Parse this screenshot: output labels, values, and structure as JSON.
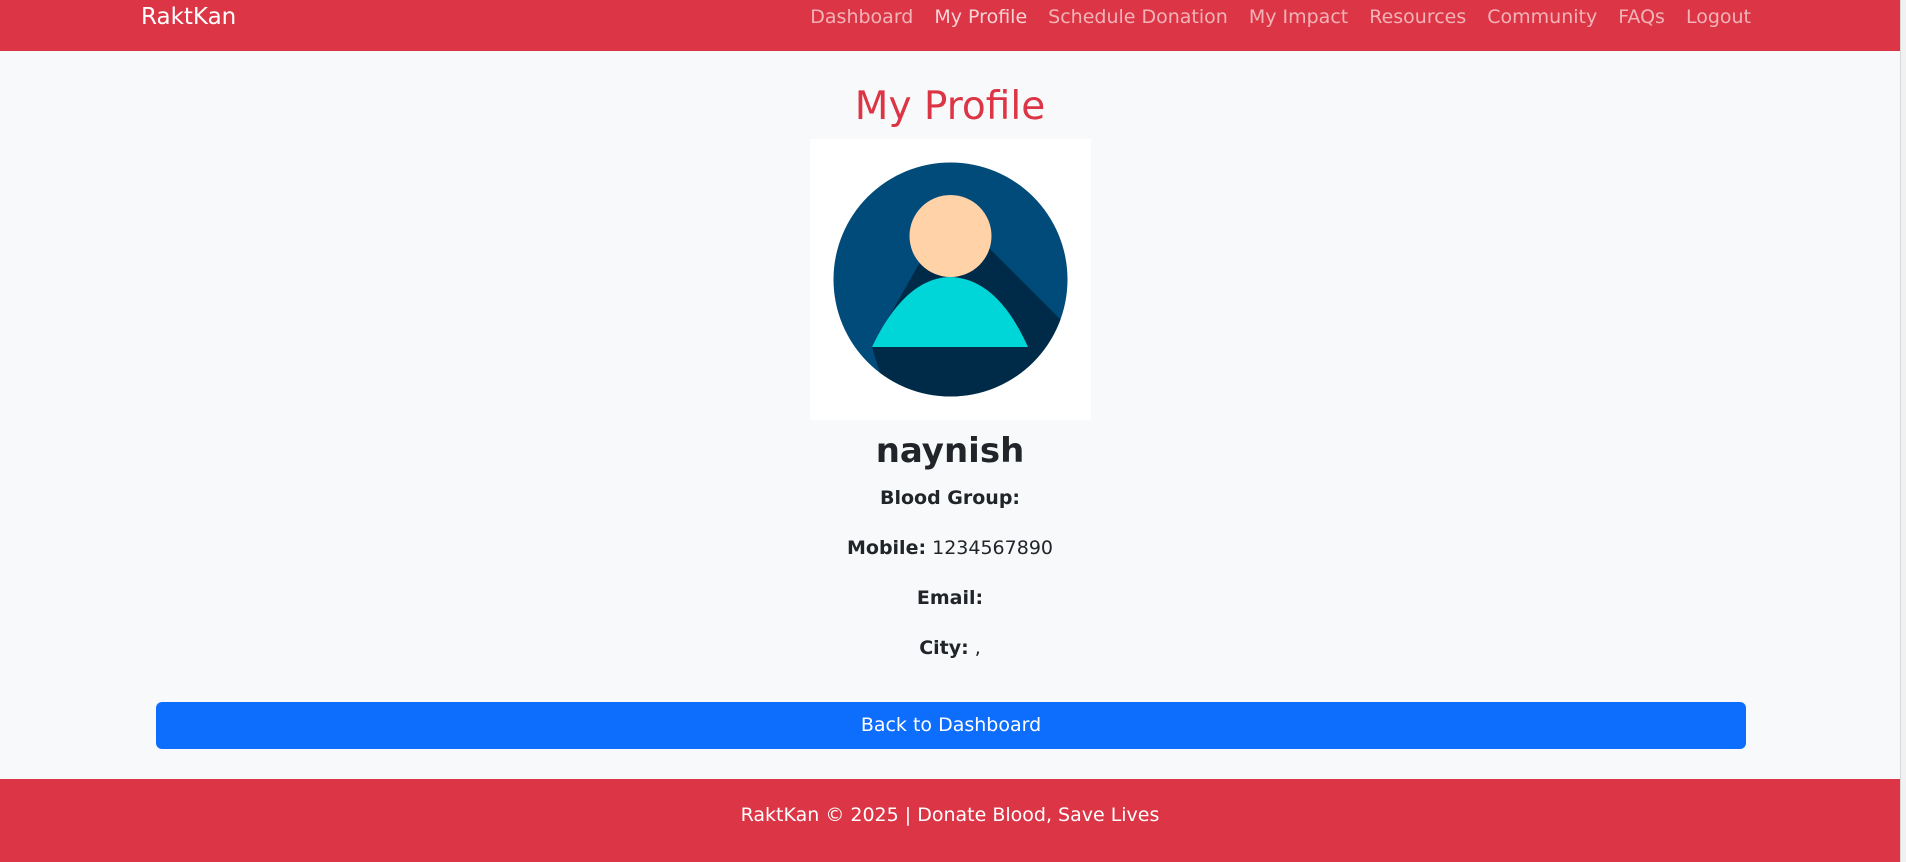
{
  "navbar": {
    "brand": "RaktKan",
    "items": [
      {
        "label": "Dashboard"
      },
      {
        "label": "My Profile"
      },
      {
        "label": "Schedule Donation"
      },
      {
        "label": "My Impact"
      },
      {
        "label": "Resources"
      },
      {
        "label": "Community"
      },
      {
        "label": "FAQs"
      },
      {
        "label": "Logout"
      }
    ]
  },
  "profile": {
    "title": "My Profile",
    "avatar_icon": "user-avatar-icon",
    "username": "naynish",
    "fields": [
      {
        "label": "Blood Group:",
        "value": ""
      },
      {
        "label": "Mobile:",
        "value": "1234567890"
      },
      {
        "label": "Email:",
        "value": ""
      },
      {
        "label": "City:",
        "value": ","
      }
    ]
  },
  "actions": {
    "back_label": "Back to Dashboard"
  },
  "footer": {
    "text": "RaktKan © 2025 | Donate Blood, Save Lives"
  },
  "colors": {
    "brand_red": "#dc3545",
    "primary_blue": "#0d6efd",
    "background": "#f8f9fa"
  }
}
